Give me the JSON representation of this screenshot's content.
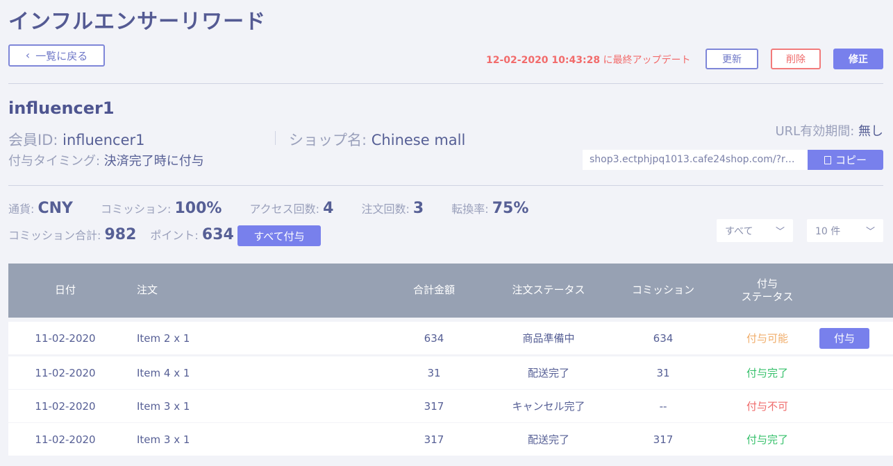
{
  "page": {
    "title": "インフルエンサーリワード"
  },
  "header": {
    "back_label": "一覧に戻る",
    "updated_time": "12-02-2020 10:43:28",
    "updated_suffix": " に最終アップデート",
    "refresh_label": "更新",
    "delete_label": "削除",
    "edit_label": "修正"
  },
  "influencer": {
    "name": "influencer1",
    "member_id_label": "会員ID: ",
    "member_id": "influencer1",
    "shop_label": "ショップ名: ",
    "shop": "Chinese mall",
    "timing_label": "付与タイミング: ",
    "timing": "決済完了時に付与",
    "url_expiry_label": "URL有効期間: ",
    "url_expiry": "無し",
    "url": "shop3.ectphjpq1013.cafe24shop.com/?ref=...",
    "copy_label": "コピー"
  },
  "stats": {
    "currency_label": "通貨: ",
    "currency": "CNY",
    "commission_label": "コミッション: ",
    "commission": "100%",
    "access_label": "アクセス回数: ",
    "access": "4",
    "orders_label": "注文回数: ",
    "orders": "3",
    "conversion_label": "転換率: ",
    "conversion": "75%",
    "commission_total_label": "コミッション合計: ",
    "commission_total": "982",
    "points_label": "ポイント: ",
    "points": "634",
    "give_all_label": "すべて付与"
  },
  "filters": {
    "status": "すべて",
    "count": "10 件"
  },
  "table": {
    "headers": {
      "date": "日付",
      "order": "注文",
      "total": "合計金額",
      "order_status": "注文ステータス",
      "commission": "コミッション",
      "grant_status_1": "付与",
      "grant_status_2": "ステータス"
    },
    "rows": [
      {
        "date": "11-02-2020",
        "order": "Item 2 x 1",
        "total": "634",
        "order_status": "商品準備中",
        "commission": "634",
        "grant_status": "付与可能",
        "action": "付与"
      },
      {
        "date": "11-02-2020",
        "order": "Item 4 x 1",
        "total": "31",
        "order_status": "配送完了",
        "commission": "31",
        "grant_status": "付与完了"
      },
      {
        "date": "11-02-2020",
        "order": "Item 3 x 1",
        "total": "317",
        "order_status": "キャンセル完了",
        "commission": "--",
        "grant_status": "付与不可"
      },
      {
        "date": "11-02-2020",
        "order": "Item 3 x 1",
        "total": "317",
        "order_status": "配送完了",
        "commission": "317",
        "grant_status": "付与完了"
      }
    ]
  },
  "icons": {
    "back": "chevron-left-icon",
    "copy": "copy-icon",
    "dropdown": "chevron-down-icon"
  }
}
